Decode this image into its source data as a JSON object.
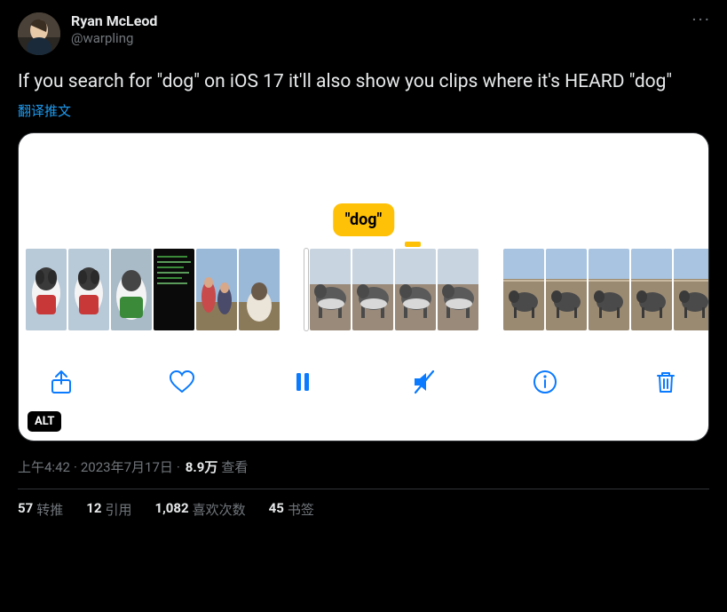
{
  "user": {
    "display_name": "Ryan McLeod",
    "handle": "@warpling"
  },
  "more_label": "···",
  "body": "If you search for \"dog\" on iOS 17 it'll also show you clips where it's HEARD \"dog\"",
  "translate_label": "翻译推文",
  "media": {
    "pill_label": "\"dog\"",
    "alt_badge": "ALT"
  },
  "meta": {
    "time": "上午4:42",
    "sep1": " · ",
    "date": "2023年7月17日",
    "sep2": " · ",
    "views_count": "8.9万",
    "views_label": " 查看"
  },
  "stats": {
    "retweets": {
      "count": "57",
      "label": "转推"
    },
    "quotes": {
      "count": "12",
      "label": "引用"
    },
    "likes": {
      "count": "1,082",
      "label": "喜欢次数"
    },
    "bookmarks": {
      "count": "45",
      "label": "书签"
    }
  }
}
